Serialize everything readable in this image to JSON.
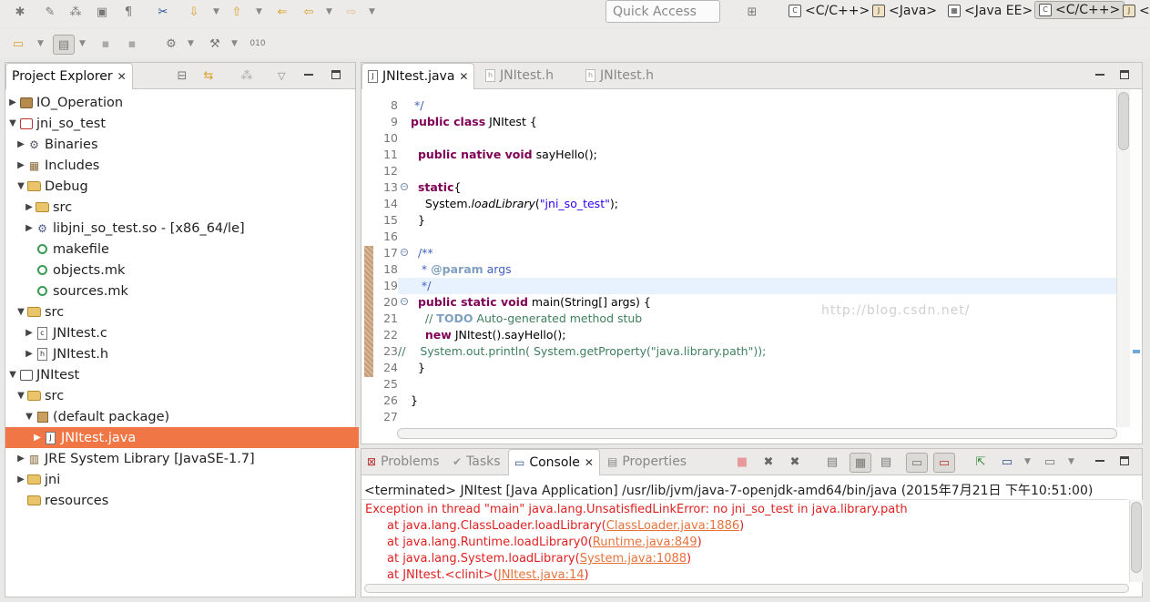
{
  "toolbar": {
    "quick_access_placeholder": "Quick Access",
    "perspectives": [
      "<C/C++>",
      "<Java>",
      "<Java EE>",
      "<C/C++>",
      "<"
    ]
  },
  "project_explorer": {
    "tab_label": "Project Explorer",
    "tree": [
      {
        "label": "IO_Operation",
        "depth": 0,
        "icon": "project-icon",
        "expanded": false
      },
      {
        "label": "jni_so_test",
        "depth": 0,
        "icon": "cpp-project-icon",
        "expanded": true
      },
      {
        "label": "Binaries",
        "depth": 1,
        "icon": "binaries-icon",
        "expanded": false
      },
      {
        "label": "Includes",
        "depth": 1,
        "icon": "includes-icon",
        "expanded": false
      },
      {
        "label": "Debug",
        "depth": 1,
        "icon": "folder-icon",
        "expanded": true
      },
      {
        "label": "src",
        "depth": 2,
        "icon": "folder-icon",
        "expanded": false
      },
      {
        "label": "libjni_so_test.so - [x86_64/le]",
        "depth": 2,
        "icon": "shared-lib-icon",
        "expanded": false
      },
      {
        "label": "makefile",
        "depth": 2,
        "icon": "makefile-icon",
        "expanded": null
      },
      {
        "label": "objects.mk",
        "depth": 2,
        "icon": "makefile-icon",
        "expanded": null
      },
      {
        "label": "sources.mk",
        "depth": 2,
        "icon": "makefile-icon",
        "expanded": null
      },
      {
        "label": "src",
        "depth": 1,
        "icon": "source-folder-icon",
        "expanded": true
      },
      {
        "label": "JNItest.c",
        "depth": 2,
        "icon": "c-file-icon",
        "expanded": false
      },
      {
        "label": "JNItest.h",
        "depth": 2,
        "icon": "h-file-icon",
        "expanded": false
      },
      {
        "label": "JNItest",
        "depth": 0,
        "icon": "java-project-icon",
        "expanded": true
      },
      {
        "label": "src",
        "depth": 1,
        "icon": "source-folder-icon",
        "expanded": true
      },
      {
        "label": "(default package)",
        "depth": 2,
        "icon": "package-icon",
        "expanded": true
      },
      {
        "label": "JNItest.java",
        "depth": 3,
        "icon": "java-file-icon",
        "expanded": false,
        "selected": true
      },
      {
        "label": "JRE System Library [JavaSE-1.7]",
        "depth": 1,
        "icon": "library-icon",
        "expanded": false
      },
      {
        "label": "jni",
        "depth": 1,
        "icon": "folder-icon",
        "expanded": false
      },
      {
        "label": "resources",
        "depth": 1,
        "icon": "folder-icon",
        "expanded": null
      }
    ]
  },
  "editor": {
    "tabs": [
      {
        "label": "JNItest.java",
        "active": true
      },
      {
        "label": "JNItest.h",
        "active": false
      },
      {
        "label": "JNItest.h",
        "active": false
      }
    ],
    "watermark": "http://blog.csdn.net/",
    "lines": [
      {
        "n": "8",
        "html_parts": [
          {
            "t": " */",
            "c": "jd"
          }
        ]
      },
      {
        "n": "9",
        "html_parts": [
          {
            "t": "public class",
            "c": "kw"
          },
          {
            "t": " JNItest {",
            "c": ""
          }
        ]
      },
      {
        "n": "10",
        "html_parts": []
      },
      {
        "n": "11",
        "html_parts": [
          {
            "t": "  ",
            "c": ""
          },
          {
            "t": "public native void",
            "c": "kw"
          },
          {
            "t": " sayHello();",
            "c": ""
          }
        ]
      },
      {
        "n": "12",
        "html_parts": []
      },
      {
        "n": "13",
        "fold": true,
        "html_parts": [
          {
            "t": "  ",
            "c": ""
          },
          {
            "t": "static",
            "c": "kw"
          },
          {
            "t": "{",
            "c": ""
          }
        ]
      },
      {
        "n": "14",
        "html_parts": [
          {
            "t": "    System.",
            "c": ""
          },
          {
            "t": "loadLibrary",
            "c": "it"
          },
          {
            "t": "(",
            "c": ""
          },
          {
            "t": "\"jni_so_test\"",
            "c": "str"
          },
          {
            "t": ");",
            "c": ""
          }
        ]
      },
      {
        "n": "15",
        "html_parts": [
          {
            "t": "  }",
            "c": ""
          }
        ]
      },
      {
        "n": "16",
        "html_parts": []
      },
      {
        "n": "17",
        "fold": true,
        "html_parts": [
          {
            "t": "  /**",
            "c": "jd"
          }
        ]
      },
      {
        "n": "18",
        "html_parts": [
          {
            "t": "   * ",
            "c": "jd"
          },
          {
            "t": "@param",
            "c": "jdtag"
          },
          {
            "t": " args",
            "c": "jd"
          }
        ]
      },
      {
        "n": "19",
        "highlight": true,
        "html_parts": [
          {
            "t": "   */",
            "c": "jd"
          }
        ]
      },
      {
        "n": "20",
        "fold": true,
        "html_parts": [
          {
            "t": "  ",
            "c": ""
          },
          {
            "t": "public static void",
            "c": "kw"
          },
          {
            "t": " main(String[] args) {",
            "c": ""
          }
        ]
      },
      {
        "n": "21",
        "html_parts": [
          {
            "t": "    // ",
            "c": "cm"
          },
          {
            "t": "TODO",
            "c": "todo"
          },
          {
            "t": " Auto-generated method stub",
            "c": "cm"
          }
        ]
      },
      {
        "n": "22",
        "html_parts": [
          {
            "t": "    ",
            "c": ""
          },
          {
            "t": "new",
            "c": "kw"
          },
          {
            "t": " JNItest().sayHello();",
            "c": ""
          }
        ]
      },
      {
        "n": "23",
        "html_parts": [
          {
            "t": "//    System.out.println( System.getProperty(\"java.library.path\"));",
            "c": "cm",
            "outdent": true
          }
        ]
      },
      {
        "n": "24",
        "html_parts": [
          {
            "t": "  }",
            "c": ""
          }
        ]
      },
      {
        "n": "25",
        "html_parts": []
      },
      {
        "n": "26",
        "html_parts": [
          {
            "t": "}",
            "c": ""
          }
        ]
      },
      {
        "n": "27",
        "html_parts": []
      }
    ]
  },
  "bottom": {
    "tabs": [
      {
        "label": "Problems",
        "active": false
      },
      {
        "label": "Tasks",
        "active": false
      },
      {
        "label": "Console",
        "active": true
      },
      {
        "label": "Properties",
        "active": false
      }
    ],
    "console_header": "<terminated> JNItest [Java Application] /usr/lib/jvm/java-7-openjdk-amd64/bin/java (2015年7月21日 下午10:51:00)",
    "console_lines": [
      {
        "pre": "Exception in thread \"main\" java.lang.UnsatisfiedLinkError: no jni_so_test in java.library.path",
        "link": "",
        "post": ""
      },
      {
        "pre": "\tat java.lang.ClassLoader.loadLibrary(",
        "link": "ClassLoader.java:1886",
        "post": ")"
      },
      {
        "pre": "\tat java.lang.Runtime.loadLibrary0(",
        "link": "Runtime.java:849",
        "post": ")"
      },
      {
        "pre": "\tat java.lang.System.loadLibrary(",
        "link": "System.java:1088",
        "post": ")"
      },
      {
        "pre": "\tat JNItest.<clinit>(",
        "link": "JNItest.java:14",
        "post": ")"
      }
    ]
  }
}
